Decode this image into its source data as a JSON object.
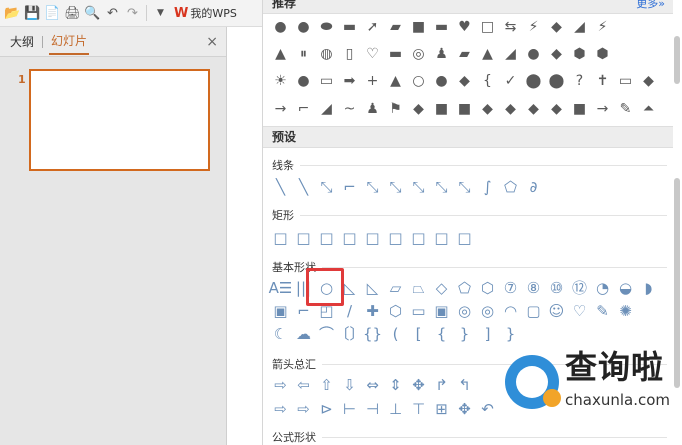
{
  "toolbar": {
    "wps_label": "我的WPS",
    "icons": [
      "open-folder-icon",
      "save-icon",
      "pdf-export-icon",
      "print-icon",
      "print-preview-icon",
      "undo-icon",
      "redo-icon",
      "dropdown-icon"
    ]
  },
  "left_panel": {
    "tabs": [
      {
        "label": "大纲"
      },
      {
        "label": "幻灯片"
      }
    ],
    "close": "×",
    "slide_number": "1"
  },
  "right_panel": {
    "top_header": "推荐",
    "more_label": "更多»",
    "preset_header": "预设",
    "categories": {
      "lines": "线条",
      "rect": "矩形",
      "basic": "基本形状",
      "arrows": "箭头总汇",
      "formula": "公式形状"
    },
    "rec_row1": [
      "●",
      "●",
      "⬬",
      "▬",
      "➚",
      "▰",
      "■",
      "▬",
      "♥",
      "□",
      "⇆",
      "⚡",
      "◆",
      "◢",
      "⚡"
    ],
    "rec_row2": [
      "▲",
      "⏸",
      "◍",
      "▯",
      "♡",
      "▬",
      "◎",
      "♟",
      "▰",
      "▲",
      "◢",
      "●",
      "◆",
      "⬢",
      "⬢"
    ],
    "rec_row3": [
      "☀",
      "●",
      "▭",
      "➡",
      "+",
      "▲",
      "○",
      "●",
      "◆",
      "{",
      "✓",
      "⬤",
      "⬤",
      "?",
      "✝",
      "▭",
      "◆"
    ],
    "rec_row4": [
      "→",
      "⌐",
      "◢",
      "~",
      "♟",
      "⚑",
      "◆",
      "■",
      "■",
      "◆",
      "◆",
      "◆",
      "◆",
      "■",
      "→",
      "✎",
      "⏶"
    ],
    "line_shapes": [
      "╲",
      "╲",
      "⤡",
      "⌐",
      "⤡",
      "⤡",
      "⤡",
      "⤡",
      "⤡",
      "∫",
      "⬠",
      "∂"
    ],
    "rect_shapes": [
      "□",
      "□",
      "□",
      "□",
      "□",
      "□",
      "□",
      "□",
      "□"
    ],
    "basic_row1": [
      "A☰",
      "|||",
      "○",
      "◺",
      "◺",
      "▱",
      "⏢",
      "◇",
      "⬠",
      "⬡",
      "⑦",
      "⑧",
      "⑩",
      "⑫",
      "◔",
      "◒",
      "◗"
    ],
    "basic_row2": [
      "▣",
      "⌐",
      "◰",
      "∕",
      "✚",
      "⬡",
      "▭",
      "▣",
      "◎",
      "◎",
      "◠",
      "▢",
      "☺",
      "♡",
      "✎",
      "✺"
    ],
    "basic_row3": [
      "☾",
      "☁",
      "⌒",
      "〔〕",
      "{}",
      "(",
      "[",
      "{",
      "}",
      "]",
      "}"
    ],
    "arrow_row1": [
      "⇨",
      "⇦",
      "⇧",
      "⇩",
      "⇔",
      "⇕",
      "✥",
      "↱",
      "↰"
    ],
    "arrow_row2": [
      "⇨",
      "⇨",
      "⊳",
      "⊢",
      "⊣",
      "⊥",
      "⊤",
      "⊞",
      "✥",
      "↶"
    ]
  },
  "watermark": {
    "big_text": "查询啦",
    "small_text": "chaxunla.com"
  }
}
